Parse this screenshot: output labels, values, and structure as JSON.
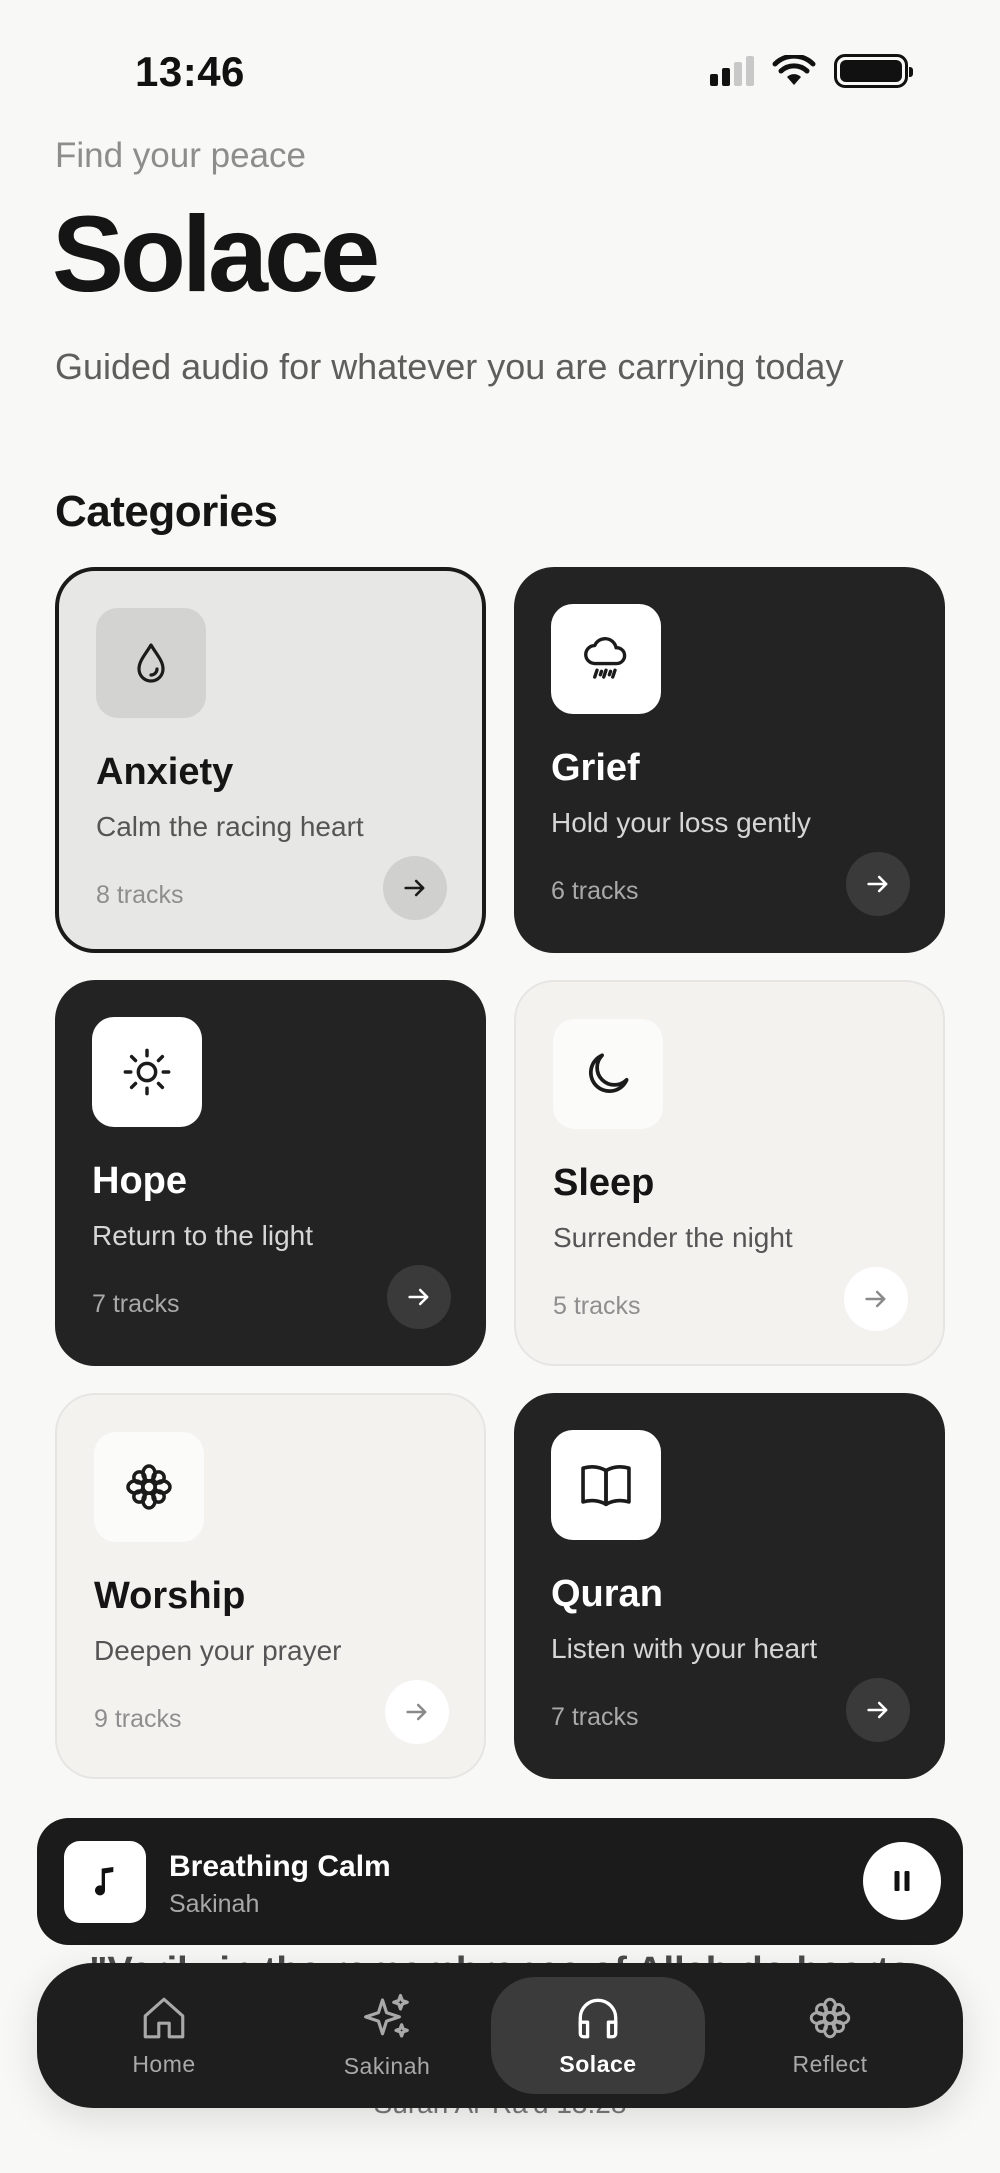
{
  "status_bar": {
    "time": "13:46"
  },
  "header": {
    "eyebrow": "Find your peace",
    "title": "Solace",
    "subtitle": "Guided audio for whatever you are carrying today"
  },
  "categories": {
    "title": "Categories",
    "items": [
      {
        "name": "Anxiety",
        "desc": "Calm the racing heart",
        "count": "8 tracks",
        "icon": "droplet-icon",
        "selected": true
      },
      {
        "name": "Grief",
        "desc": "Hold your loss gently",
        "count": "6 tracks",
        "icon": "cloud-rain-icon"
      },
      {
        "name": "Hope",
        "desc": "Return to the light",
        "count": "7 tracks",
        "icon": "sun-icon"
      },
      {
        "name": "Sleep",
        "desc": "Surrender the night",
        "count": "5 tracks",
        "icon": "moon-icon"
      },
      {
        "name": "Worship",
        "desc": "Deepen your prayer",
        "count": "9 tracks",
        "icon": "flower-icon"
      },
      {
        "name": "Quran",
        "desc": "Listen with your heart",
        "count": "7 tracks",
        "icon": "book-icon"
      }
    ]
  },
  "now_playing": {
    "title": "Breathing Calm",
    "subtitle": "Sakinah",
    "icon": "music-note-icon",
    "control_icon": "pause-icon"
  },
  "background_text": {
    "line1": "\"Verily in the remembrance of Allah do hearts",
    "line2": "Surah Ar-Ra'd 13:28"
  },
  "tabs": [
    {
      "label": "Home",
      "icon": "home-icon"
    },
    {
      "label": "Sakinah",
      "icon": "sparkles-icon"
    },
    {
      "label": "Solace",
      "icon": "headphones-icon",
      "active": true
    },
    {
      "label": "Reflect",
      "icon": "flower-icon"
    }
  ],
  "colors": {
    "background": "#f8f8f6",
    "dark_card": "#232323",
    "light_card": "#f3f2ef",
    "selected_card": "#e7e7e6"
  }
}
